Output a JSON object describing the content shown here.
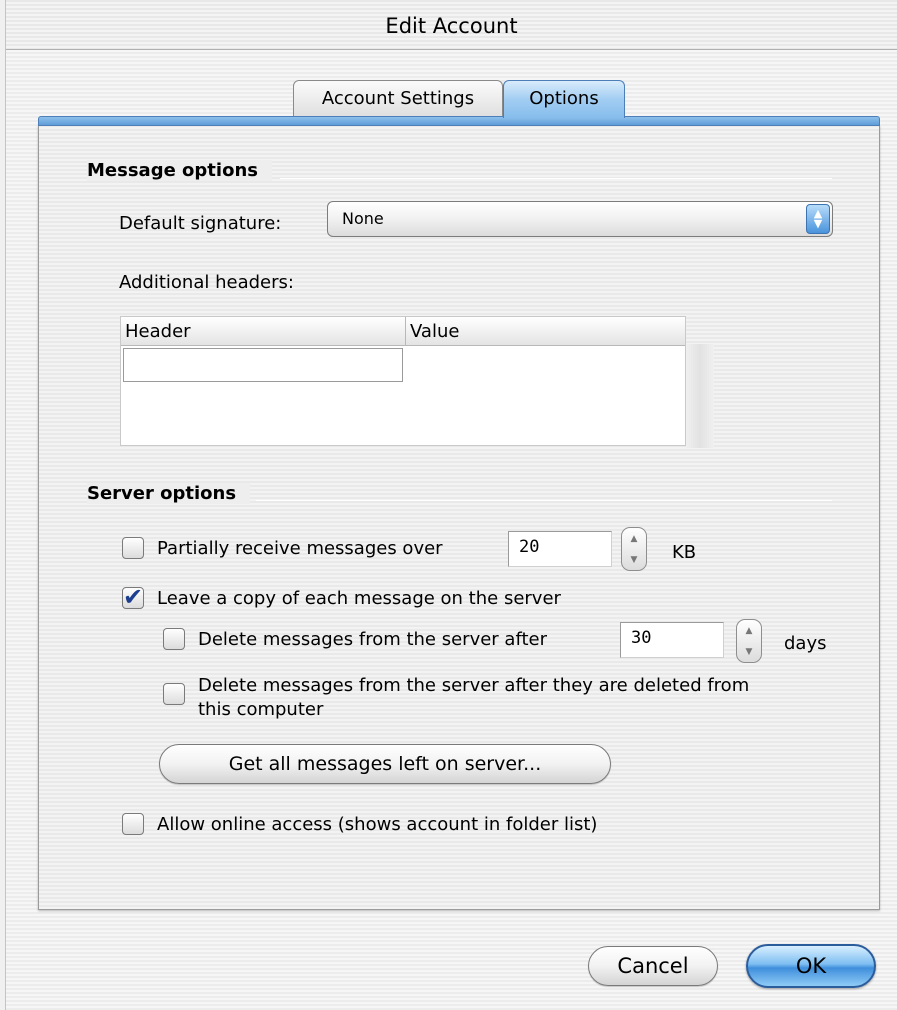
{
  "window": {
    "title": "Edit Account"
  },
  "tabs": [
    {
      "label": "Account Settings",
      "active": false
    },
    {
      "label": "Options",
      "active": true
    }
  ],
  "message_options": {
    "section_title": "Message options",
    "signature_label": "Default signature:",
    "signature_value": "None",
    "headers_label": "Additional headers:",
    "table_columns": [
      "Header",
      "Value"
    ],
    "header_input_value": ""
  },
  "server_options": {
    "section_title": "Server options",
    "partial_label": "Partially receive messages over",
    "partial_value": "20",
    "partial_unit": "KB",
    "partial_checked": false,
    "leave_copy_label": "Leave a copy of each message on the server",
    "leave_copy_checked": true,
    "delete_after_label": "Delete messages from the server after",
    "delete_after_value": "30",
    "delete_after_unit": "days",
    "delete_after_checked": false,
    "delete_deleted_label_line1": "Delete messages from the server after they are deleted from",
    "delete_deleted_label_line2": "this computer",
    "delete_deleted_checked": false,
    "get_all_button": "Get all messages left on server...",
    "online_access_label": "Allow online access (shows account in folder list)",
    "online_access_checked": false
  },
  "footer": {
    "cancel_label": "Cancel",
    "ok_label": "OK"
  },
  "glyphs": {
    "check": "✔",
    "arrow_up": "▲",
    "arrow_down": "▼"
  },
  "colors": {
    "accent_blue": "#5f9dd8",
    "ok_blue": "#3f8fdc",
    "check_color": "#1c3f8f"
  }
}
